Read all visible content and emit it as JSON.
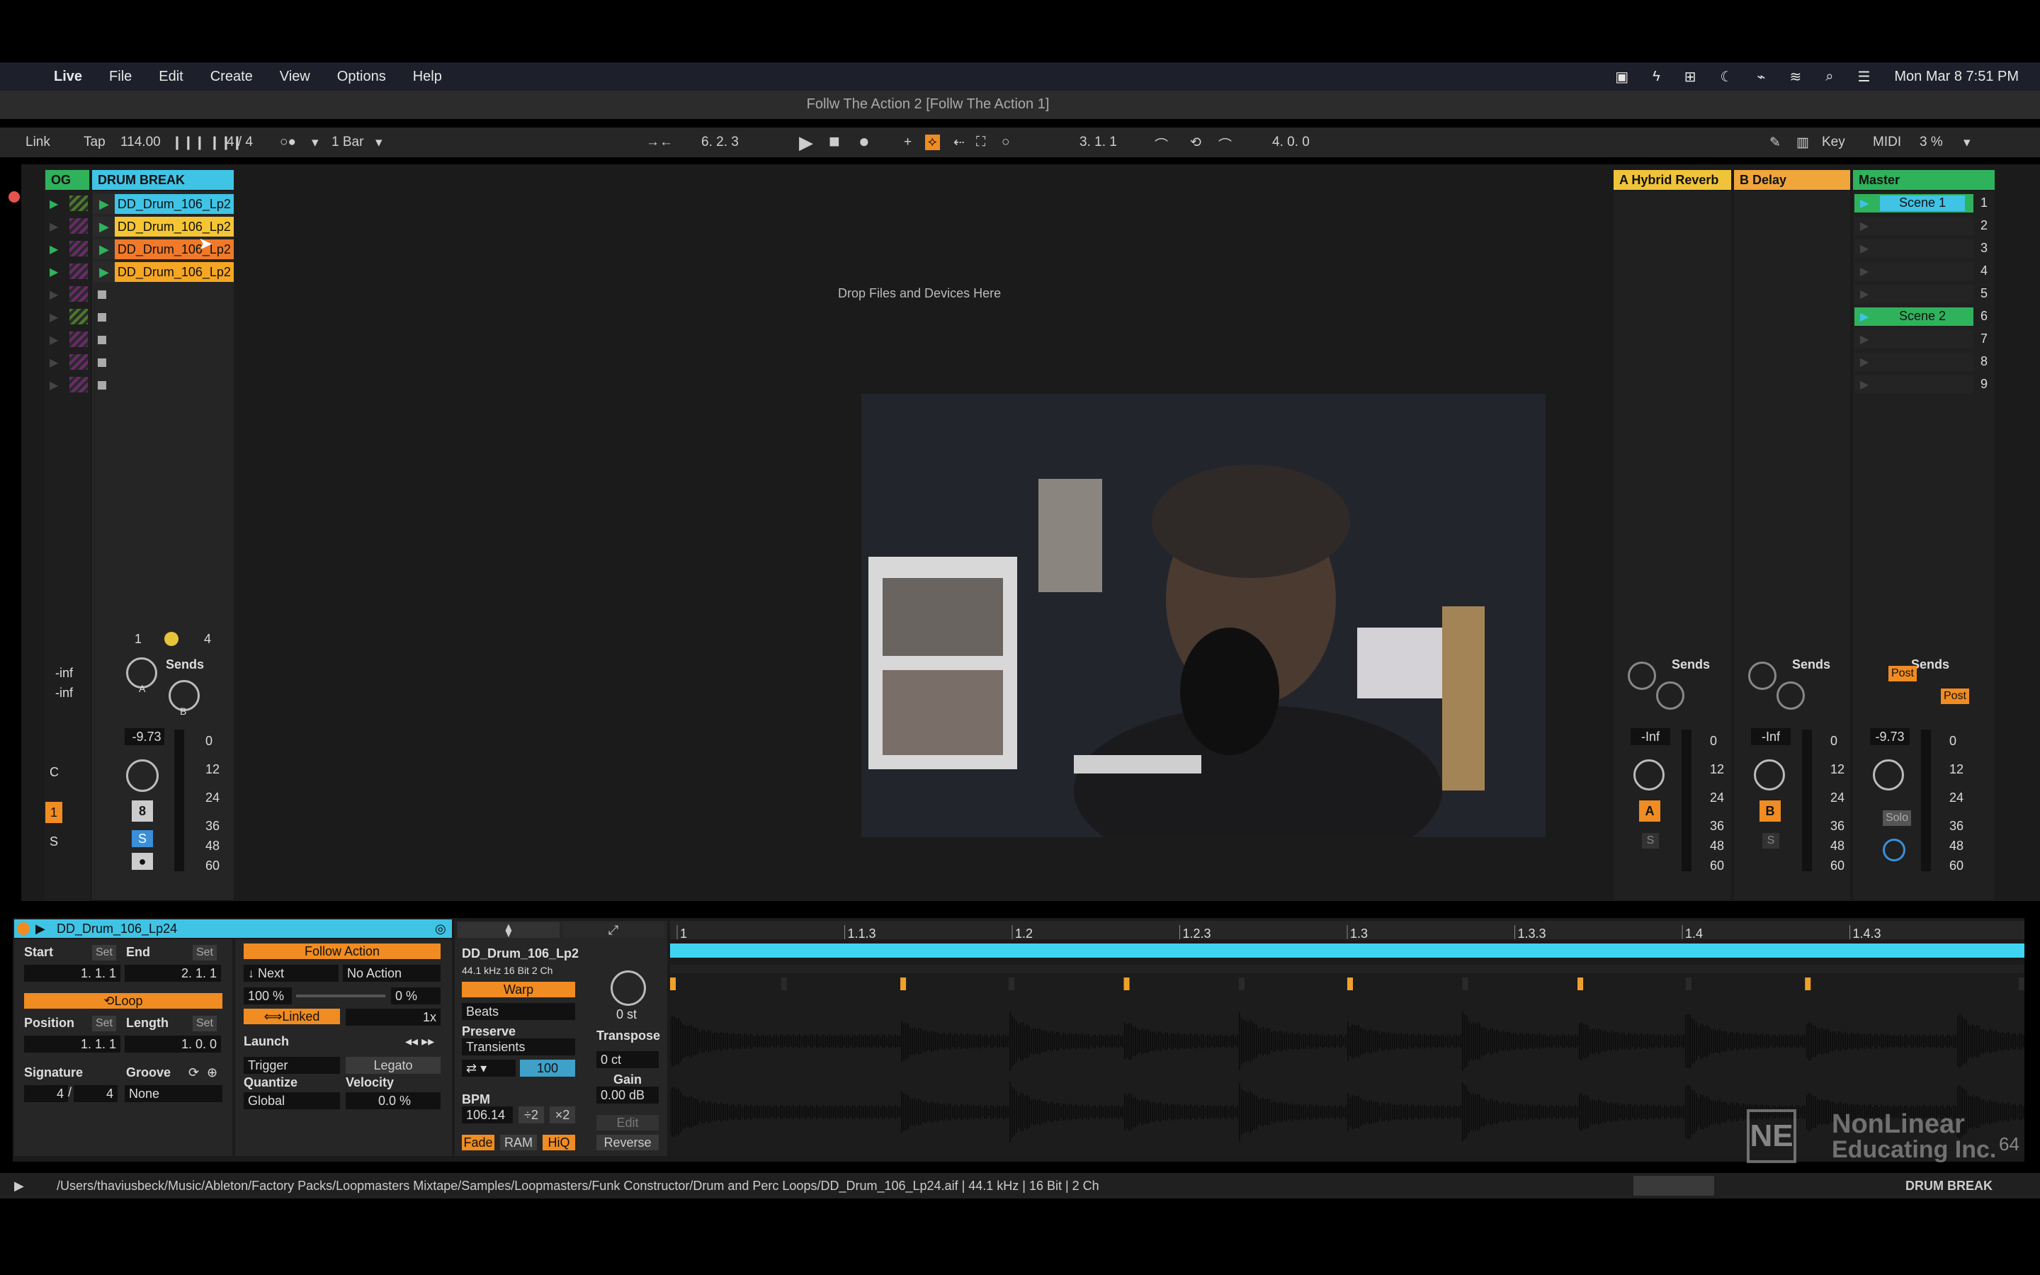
{
  "menubar": {
    "items": [
      "Live",
      "File",
      "Edit",
      "Create",
      "View",
      "Options",
      "Help"
    ],
    "clock": "Mon Mar 8  7:51 PM"
  },
  "window": {
    "title": "Follw The Action 2  [Follw The Action 1]"
  },
  "toolbar": {
    "link": "Link",
    "tap": "Tap",
    "tempo": "114.00",
    "signature": "4 / 4",
    "quantize": "1 Bar",
    "arrangement_position": "6.   2.   3",
    "loop_start": "3.   1.   1",
    "loop_length": "4.   0.   0",
    "key": "Key",
    "midi": "MIDI",
    "cpu": "3 %"
  },
  "track": {
    "name": "DRUM BREAK",
    "group_label": "OG",
    "clips": [
      "DD_Drum_106_Lp2",
      "DD_Drum_106_Lp2",
      "DD_Drum_106_Lp2",
      "DD_Drum_106_Lp2"
    ],
    "clip_colors": [
      "#3fc4e6",
      "#f5c534",
      "#f07a2a",
      "#f5a623"
    ],
    "io_in": "-inf",
    "io_out": "-inf",
    "sends_label": "Sends",
    "send_a": "A",
    "send_b": "B",
    "volume": "-9.73",
    "track_number": "8",
    "solo": "S",
    "num_1": "1",
    "num_4": "4",
    "meter_ticks": [
      "0",
      "12",
      "24",
      "36",
      "48",
      "60"
    ]
  },
  "drop_zone": "Drop Files and Devices Here",
  "returns": [
    {
      "name": "A Hybrid Reverb",
      "color": "#f0c43a",
      "letter": "A",
      "volume": "-Inf"
    },
    {
      "name": "B Delay",
      "color": "#f0a63a",
      "letter": "B",
      "volume": "-Inf"
    }
  ],
  "master": {
    "name": "Master",
    "volume": "-9.73",
    "solo": "Solo",
    "post": "Post",
    "scenes": [
      "Scene 1",
      "",
      "",
      "",
      "",
      "Scene 2",
      "",
      "",
      ""
    ],
    "scene_numbers": [
      "1",
      "2",
      "3",
      "4",
      "5",
      "6",
      "7",
      "8",
      "9"
    ]
  },
  "clip_view": {
    "clip_name": "DD_Drum_106_Lp24",
    "start_label": "Start",
    "end_label": "End",
    "set": "Set",
    "start": "1.   1.   1",
    "end": "2.   1.   1",
    "loop": "Loop",
    "position_label": "Position",
    "length_label": "Length",
    "position": "1.   1.   1",
    "length": "1.   0.   0",
    "signature_label": "Signature",
    "groove_label": "Groove",
    "sig_num": "4",
    "sig_den": "4",
    "groove": "None",
    "follow_action": "Follow Action",
    "fa_a": "Next",
    "fa_b": "No Action",
    "fa_chance_a": "100 %",
    "fa_chance_b": "0 %",
    "linked": "Linked",
    "multiplier": "1x",
    "launch": "Launch",
    "launch_mode": "Trigger",
    "legato": "Legato",
    "quantize_label": "Quantize",
    "velocity_label": "Velocity",
    "quantize": "Global",
    "velocity": "0.0 %",
    "sample_name": "DD_Drum_106_Lp2",
    "sample_info": "44.1 kHz   16 Bit   2 Ch",
    "warp": "Warp",
    "warp_mode": "Beats",
    "preserve_label": "Preserve",
    "preserve": "Transients",
    "grain": "100",
    "bpm_label": "BPM",
    "bpm": "106.14",
    "half": "÷2",
    "double": "×2",
    "fade": "Fade",
    "ram": "RAM",
    "hiq": "HiQ",
    "transpose_value": "0 st",
    "transpose_label": "Transpose",
    "detune": "0 ct",
    "gain_label": "Gain",
    "gain": "0.00 dB",
    "edit": "Edit",
    "reverse": "Reverse",
    "ruler": [
      "1",
      "1.1.3",
      "1.2",
      "1.2.3",
      "1.3",
      "1.3.3",
      "1.4",
      "1.4.3"
    ]
  },
  "status": {
    "path": "/Users/thaviusbeck/Music/Ableton/Factory Packs/Loopmasters Mixtape/Samples/Loopmasters/Funk Constructor/Drum and Perc Loops/DD_Drum_106_Lp24.aif | 44.1 kHz | 16 Bit | 2 Ch",
    "track": "DRUM BREAK"
  },
  "watermark": {
    "line1": "NonLinear",
    "line2": "Educating Inc.",
    "mark": "NE",
    "counter": "64"
  },
  "colors": {
    "accent_blue": "#3fc4e6",
    "accent_orange": "#f08c22",
    "green": "#2fb25c"
  }
}
